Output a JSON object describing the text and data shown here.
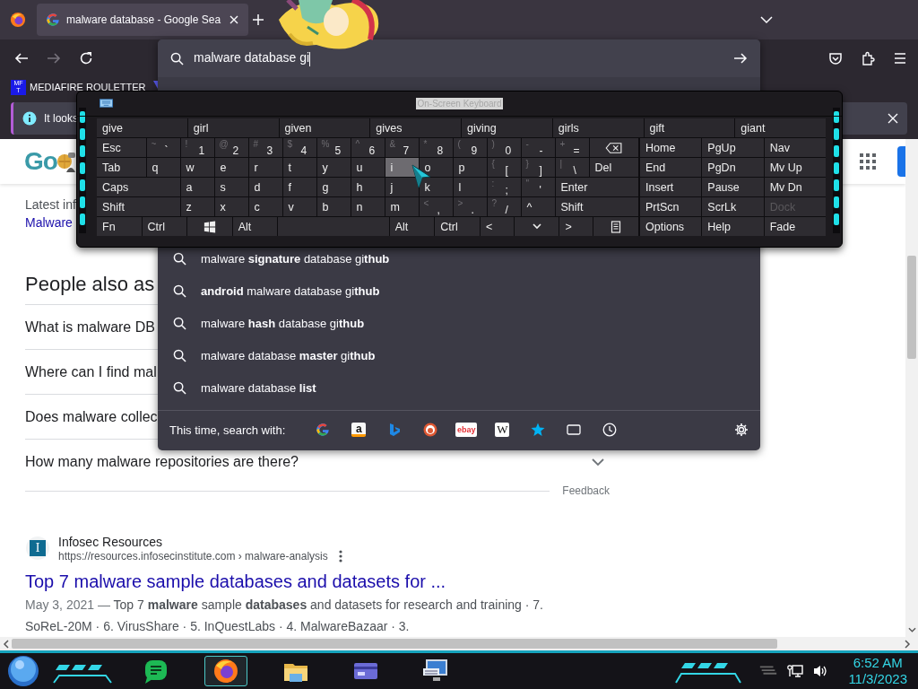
{
  "tabs": [
    {
      "title": "malware database - Google Sea",
      "selected": true
    }
  ],
  "navigation": {
    "back_disabled": false,
    "forward_disabled": true
  },
  "address_bar": {
    "value": "malware database gi"
  },
  "bookmarks": [
    {
      "label": "MEDIAFIRE ROULETTER",
      "icon_text": [
        "MF",
        "T"
      ]
    }
  ],
  "notification": {
    "text": "It looks"
  },
  "page": {
    "logo": "Go",
    "snippet": "Latest inf",
    "link": "Malware",
    "paa_title": "People also as",
    "questions": [
      {
        "text": "What is malware DB"
      },
      {
        "text": "Where can I find mal"
      },
      {
        "text": "Does malware collec"
      }
    ],
    "last_question": {
      "text": "How many malware repositories are there?"
    },
    "feedback": "Feedback",
    "result": {
      "site": "Infosec Resources",
      "favicon": "I",
      "url": "https://resources.infosecinstitute.com › malware-analysis",
      "title": "Top 7 malware sample databases and datasets for ...",
      "date": "May 3, 2021 —",
      "snippet": "Top 7 **malware** sample **databases** and datasets for research and training · 7.",
      "snippet_2": "SoReL-20M · 6. VirusShare · 5. InQuestLabs · 4. MalwareBazaar · 3."
    }
  },
  "suggestions": [
    {
      "text": "malware **signature** database gi**thub**"
    },
    {
      "text": "**android** malware database gi**thub**"
    },
    {
      "text": "malware **hash** database gi**thub**"
    },
    {
      "text": "malware database **master** gi**thub**"
    },
    {
      "text": "malware database **list**"
    }
  ],
  "search_with": {
    "label": "This time, search with:",
    "engines": [
      {
        "kind": "google"
      },
      {
        "kind": "amazon",
        "label": "a"
      },
      {
        "kind": "bing"
      },
      {
        "kind": "duckduckgo"
      },
      {
        "kind": "ebay",
        "label": "ebay"
      },
      {
        "kind": "wikipedia",
        "label": "W"
      },
      {
        "kind": "bookmarks"
      },
      {
        "kind": "tabs"
      },
      {
        "kind": "history"
      }
    ]
  },
  "keyboard": {
    "title": "On-Screen Keyboard",
    "predictions": [
      "give",
      "girl",
      "given",
      "gives",
      "giving",
      "girls",
      "gift",
      "giant"
    ],
    "rows": [
      {
        "keys": [
          {
            "kind": "label",
            "label": "Esc",
            "selected": false
          },
          {
            "kind": "char",
            "shift": "~",
            "main": "`",
            "selected": false
          },
          {
            "kind": "char",
            "shift": "!",
            "main": "1",
            "selected": false
          },
          {
            "kind": "char",
            "shift": "@",
            "main": "2",
            "selected": false
          },
          {
            "kind": "char",
            "shift": "#",
            "main": "3",
            "selected": false
          },
          {
            "kind": "char",
            "shift": "$",
            "main": "4",
            "selected": false
          },
          {
            "kind": "char",
            "shift": "%",
            "main": "5",
            "selected": false
          },
          {
            "kind": "char",
            "shift": "^",
            "main": "6",
            "selected": false
          },
          {
            "kind": "char",
            "shift": "&",
            "main": "7",
            "selected": false
          },
          {
            "kind": "char",
            "shift": "*",
            "main": "8",
            "selected": false
          },
          {
            "kind": "char",
            "shift": "(",
            "main": "9",
            "selected": false
          },
          {
            "kind": "char",
            "shift": ")",
            "main": "0",
            "selected": false
          },
          {
            "kind": "char",
            "shift": "-",
            "main": "-",
            "selected": false
          },
          {
            "kind": "char",
            "shift": "+",
            "main": "=",
            "selected": false
          },
          {
            "kind": "backspace",
            "selected": false
          }
        ]
      },
      {
        "keys": [
          {
            "kind": "label",
            "label": "Tab",
            "selected": false
          },
          {
            "kind": "letter",
            "label": "q",
            "selected": false
          },
          {
            "kind": "letter",
            "label": "w",
            "selected": false
          },
          {
            "kind": "letter",
            "label": "e",
            "selected": false
          },
          {
            "kind": "letter",
            "label": "r",
            "selected": false
          },
          {
            "kind": "letter",
            "label": "t",
            "selected": false
          },
          {
            "kind": "letter",
            "label": "y",
            "selected": false
          },
          {
            "kind": "letter",
            "label": "u",
            "selected": false
          },
          {
            "kind": "letter",
            "label": "i",
            "selected": true
          },
          {
            "kind": "letter",
            "label": "o",
            "selected": false
          },
          {
            "kind": "letter",
            "label": "p",
            "selected": false
          },
          {
            "kind": "char",
            "shift": "{",
            "main": "[",
            "selected": false
          },
          {
            "kind": "char",
            "shift": "}",
            "main": "]",
            "selected": false
          },
          {
            "kind": "char",
            "shift": "|",
            "main": "\\",
            "selected": false
          },
          {
            "kind": "label",
            "label": "Del",
            "selected": false
          }
        ]
      },
      {
        "keys": [
          {
            "kind": "label",
            "label": "Caps",
            "selected": false
          },
          {
            "kind": "letter",
            "label": "a",
            "selected": false
          },
          {
            "kind": "letter",
            "label": "s",
            "selected": false
          },
          {
            "kind": "letter",
            "label": "d",
            "selected": false
          },
          {
            "kind": "letter",
            "label": "f",
            "selected": false
          },
          {
            "kind": "letter",
            "label": "g",
            "selected": false
          },
          {
            "kind": "letter",
            "label": "h",
            "selected": false
          },
          {
            "kind": "letter",
            "label": "j",
            "selected": false
          },
          {
            "kind": "letter",
            "label": "k",
            "selected": false
          },
          {
            "kind": "letter",
            "label": "l",
            "selected": false
          },
          {
            "kind": "char",
            "shift": ":",
            "main": ";",
            "selected": false
          },
          {
            "kind": "char",
            "shift": "\"",
            "main": "'",
            "selected": false
          },
          {
            "kind": "label",
            "label": "Enter",
            "selected": false
          }
        ]
      },
      {
        "keys": [
          {
            "kind": "label",
            "label": "Shift",
            "selected": false
          },
          {
            "kind": "letter",
            "label": "z",
            "selected": false
          },
          {
            "kind": "letter",
            "label": "x",
            "selected": false
          },
          {
            "kind": "letter",
            "label": "c",
            "selected": false
          },
          {
            "kind": "letter",
            "label": "v",
            "selected": false
          },
          {
            "kind": "letter",
            "label": "b",
            "selected": false
          },
          {
            "kind": "letter",
            "label": "n",
            "selected": false
          },
          {
            "kind": "letter",
            "label": "m",
            "selected": false
          },
          {
            "kind": "char",
            "shift": "<",
            "main": ",",
            "selected": false
          },
          {
            "kind": "char",
            "shift": ">",
            "main": ".",
            "selected": false
          },
          {
            "kind": "char",
            "shift": "?",
            "main": "/",
            "selected": false
          },
          {
            "kind": "letter",
            "label": "^",
            "selected": false
          },
          {
            "kind": "label",
            "label": "Shift",
            "selected": false
          }
        ]
      },
      {
        "keys": [
          {
            "kind": "label",
            "label": "Fn",
            "selected": false
          },
          {
            "kind": "label",
            "label": "Ctrl",
            "selected": false
          },
          {
            "kind": "windows",
            "selected": false
          },
          {
            "kind": "label",
            "label": "Alt",
            "selected": false
          },
          {
            "kind": "space",
            "selected": false
          },
          {
            "kind": "label",
            "label": "Alt",
            "selected": false
          },
          {
            "kind": "label",
            "label": "Ctrl",
            "selected": false
          },
          {
            "kind": "letter",
            "label": "<",
            "selected": false
          },
          {
            "kind": "down",
            "selected": false
          },
          {
            "kind": "letter",
            "label": ">",
            "selected": false
          },
          {
            "kind": "menu",
            "selected": false
          }
        ]
      }
    ],
    "nav": [
      [
        {
          "label": "Home",
          "disabled": false
        },
        {
          "label": "PgUp",
          "disabled": false
        },
        {
          "label": "Nav",
          "disabled": false
        }
      ],
      [
        {
          "label": "End",
          "disabled": false
        },
        {
          "label": "PgDn",
          "disabled": false
        },
        {
          "label": "Mv Up",
          "disabled": false
        }
      ],
      [
        {
          "label": "Insert",
          "disabled": false
        },
        {
          "label": "Pause",
          "disabled": false
        },
        {
          "label": "Mv Dn",
          "disabled": false
        }
      ],
      [
        {
          "label": "PrtScn",
          "disabled": false
        },
        {
          "label": "ScrLk",
          "disabled": false
        },
        {
          "label": "Dock",
          "disabled": true
        }
      ],
      [
        {
          "label": "Options",
          "disabled": false
        },
        {
          "label": "Help",
          "disabled": false
        },
        {
          "label": "Fade",
          "disabled": false
        }
      ]
    ]
  },
  "taskbar": {
    "apps": [
      {
        "kind": "chat",
        "selected": false
      },
      {
        "kind": "firefox",
        "selected": true
      },
      {
        "kind": "folder",
        "selected": false
      },
      {
        "kind": "card",
        "selected": false
      },
      {
        "kind": "keyboard",
        "selected": false
      }
    ],
    "time": "6:52 AM",
    "date": "11/3/2023"
  }
}
